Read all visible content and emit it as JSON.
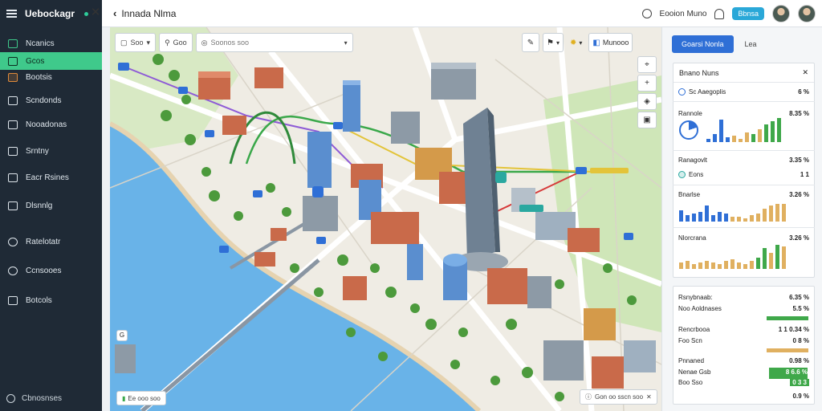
{
  "app": {
    "brand": "Uebockagr",
    "title": "Innada Nlma"
  },
  "sidebar": {
    "items": [
      {
        "label": "Ncanics",
        "icon": "dashboard-icon"
      },
      {
        "label": "Gcos",
        "icon": "map-icon",
        "active": true
      },
      {
        "label": "Bootsis",
        "icon": "layers-icon"
      },
      {
        "label": "Scndonds",
        "icon": "transit-icon"
      },
      {
        "label": "Nooadonas",
        "icon": "chart-icon"
      },
      {
        "label": "Srntny",
        "icon": "list-icon"
      },
      {
        "label": "Eacr Rsines",
        "icon": "folder-icon"
      },
      {
        "label": "Dlsnnlg",
        "icon": "document-icon"
      },
      {
        "label": "Ratelotatr",
        "icon": "gauge-icon"
      },
      {
        "label": "Ccnsooes",
        "icon": "pin-icon"
      },
      {
        "label": "Botcols",
        "icon": "settings-icon"
      }
    ],
    "footer": "Cbnosnses"
  },
  "topbar": {
    "user_label": "Eooion Muno",
    "badge": "Bbnsa"
  },
  "map_toolbar": {
    "layer_select": "Soo",
    "filter_label": "Goo",
    "search_placeholder": "Soonos soo"
  },
  "map_tools": {
    "layers_button": "Munooo"
  },
  "map_footer": {
    "scale": "Ee ooo soo",
    "attribution": "Gon oo sscn soo"
  },
  "map_labels": {
    "pin": "G"
  },
  "panel": {
    "tab_active": "Goarsi Nonla",
    "tab_inactive": "Lea",
    "card1": {
      "title": "Bnano Nuns",
      "row1": {
        "label": "Sc Aaegoplis",
        "value": "6 %"
      },
      "row2": {
        "label": "Rannole",
        "value": "8.35 %"
      },
      "row3": {
        "label": "Ranagovlt",
        "value": "3.35 %"
      },
      "row4": {
        "label": "Eons",
        "value": "1 1"
      },
      "row5": {
        "label": "Bnarlse",
        "value": "3.26 %"
      },
      "row6": {
        "label": "Nlorcrana",
        "value": "3.26 %"
      }
    },
    "card2": {
      "row1": {
        "label": "Rsnybnaab:",
        "value": "6.35 %"
      },
      "row2": {
        "label": "Noo Aoldnases",
        "value": "5.5 %"
      },
      "row3": {
        "label": "Rencrbooa",
        "value": "1 1 0.34 %"
      },
      "row4": {
        "label": "Foo Scn",
        "value": "0 8 %"
      },
      "row5": {
        "label": "Pnnaned",
        "value": "0.98 %"
      },
      "row6": {
        "label": "Nenae Gsb",
        "value": "8 6.6 %"
      },
      "row7": {
        "label": "Boo Sso",
        "value": "0 3 3"
      },
      "row8": {
        "label": "",
        "value": "0.9 %"
      }
    }
  },
  "colors": {
    "sidebar_bg": "#1f2a36",
    "accent_green": "#3fc98b",
    "primary_blue": "#2f6fd6",
    "water": "#69b3e8",
    "park": "#cfe6b8"
  }
}
